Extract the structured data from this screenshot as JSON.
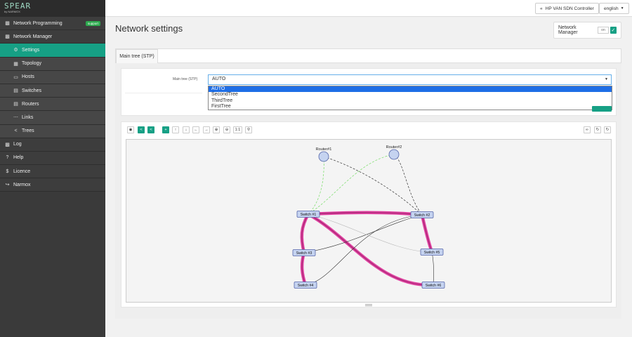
{
  "logo": {
    "title": "SPEAR",
    "subtitle": "by NARMOX"
  },
  "sidebar": {
    "items": [
      {
        "label": "Network Programming",
        "icon": "briefcase-icon",
        "badge": "support"
      },
      {
        "label": "Network Manager",
        "icon": "briefcase-icon"
      },
      {
        "label": "Settings",
        "icon": "gear-icon",
        "active": true
      },
      {
        "label": "Topology",
        "icon": "map-icon"
      },
      {
        "label": "Hosts",
        "icon": "laptop-icon"
      },
      {
        "label": "Switches",
        "icon": "hdd-icon"
      },
      {
        "label": "Routers",
        "icon": "hdd-icon"
      },
      {
        "label": "Links",
        "icon": "dots-icon"
      },
      {
        "label": "Trees",
        "icon": "share-icon"
      },
      {
        "label": "Log",
        "icon": "folder-icon"
      },
      {
        "label": "Help",
        "icon": "question-icon"
      },
      {
        "label": "Licence",
        "icon": "dollar-icon"
      },
      {
        "label": "Narmox",
        "icon": "wrench-icon"
      }
    ]
  },
  "topbar": {
    "controller": "HP VAN SDN Controller",
    "language": "english"
  },
  "page": {
    "title": "Network settings"
  },
  "network_manager": {
    "label": "Network Manager",
    "toggle": "on"
  },
  "tabs": [
    {
      "label": "Main tree (STP)"
    }
  ],
  "form": {
    "label": "Main tree (STP)",
    "selected": "AUTO",
    "options": [
      "AUTO",
      "SecondTree",
      "ThirdTree",
      "FirstTree"
    ]
  },
  "toolbar": {
    "zoom_reset": "1:1"
  },
  "graph": {
    "nodes": [
      {
        "id": "r1",
        "label": "Router#1",
        "type": "router"
      },
      {
        "id": "r2",
        "label": "Router#2",
        "type": "router"
      },
      {
        "id": "s1",
        "label": "Switch #1",
        "type": "switch"
      },
      {
        "id": "s2",
        "label": "Switch #2",
        "type": "switch"
      },
      {
        "id": "s3",
        "label": "Switch #3",
        "type": "switch"
      },
      {
        "id": "s4",
        "label": "Switch #4",
        "type": "switch"
      },
      {
        "id": "s5",
        "label": "Switch #5",
        "type": "switch"
      },
      {
        "id": "s6",
        "label": "Switch #6",
        "type": "switch"
      }
    ],
    "colors": {
      "tree": "#e040a0",
      "router_link_active": "#77dd66",
      "node_fill": "#c5d3f0",
      "node_stroke": "#5566aa"
    }
  }
}
